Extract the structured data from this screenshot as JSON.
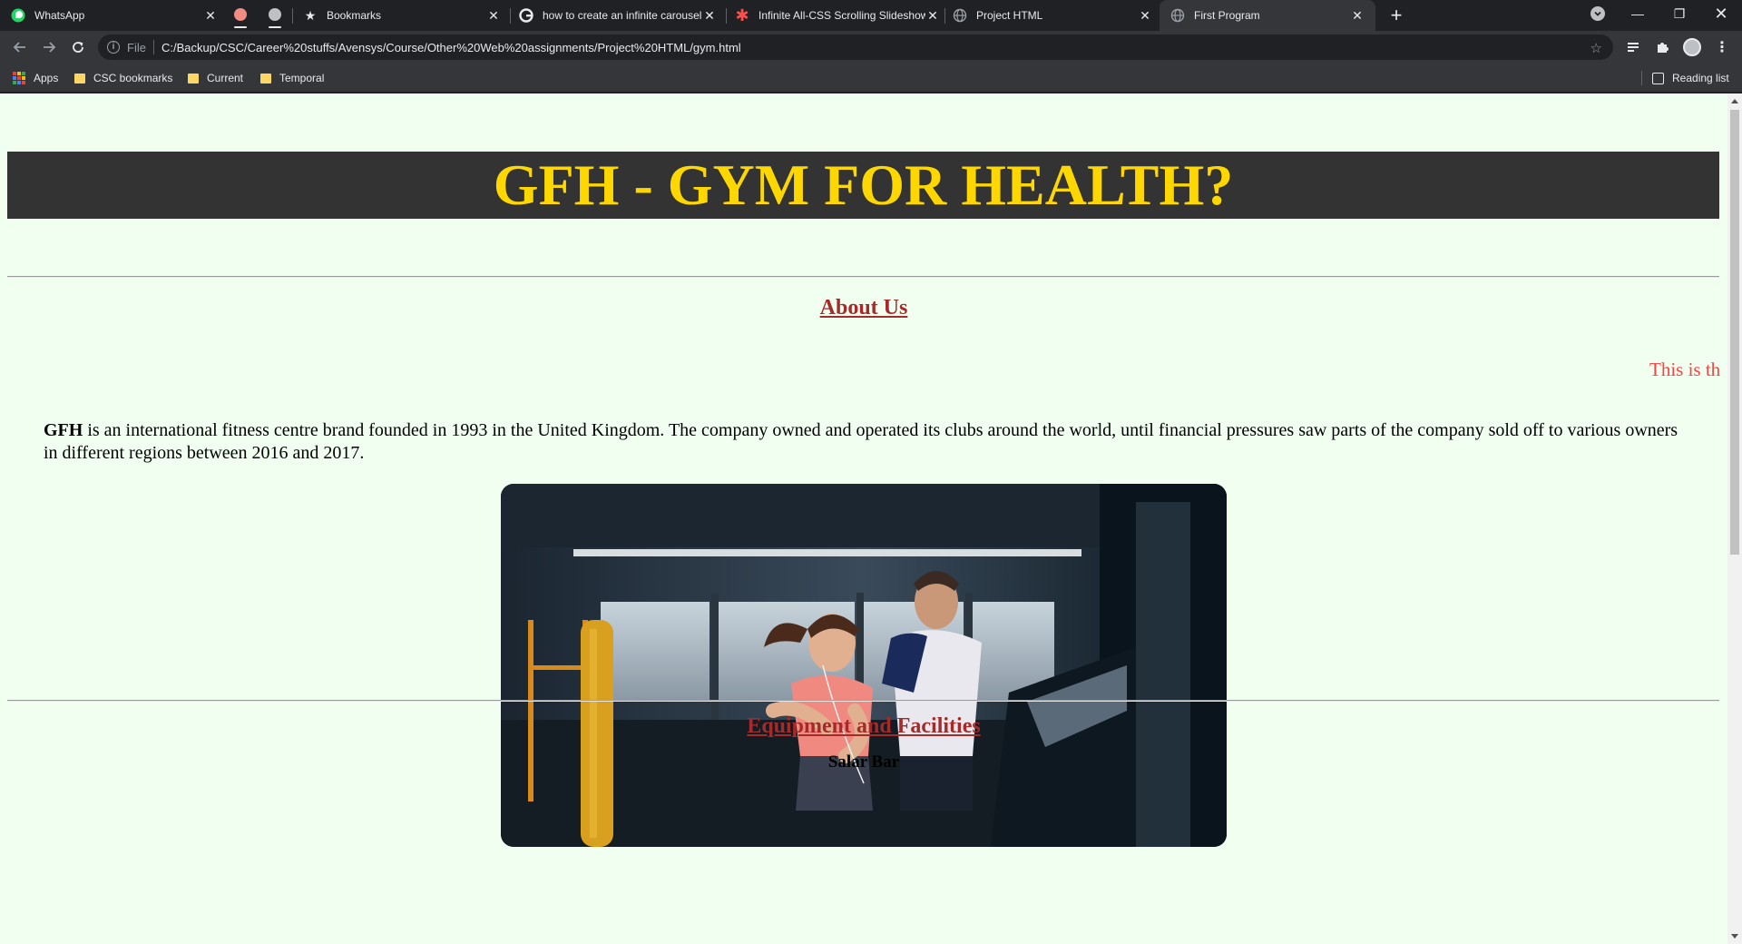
{
  "browser": {
    "tabs": [
      {
        "title": "WhatsApp",
        "icon": "whatsapp-icon"
      },
      {
        "title": "Bookmarks",
        "icon": "star-icon"
      },
      {
        "title": "how to create an infinite carousel",
        "icon": "google-icon"
      },
      {
        "title": "Infinite All-CSS Scrolling Slideshow",
        "icon": "asterisk-icon"
      },
      {
        "title": "Project HTML",
        "icon": "globe-icon"
      },
      {
        "title": "First Program",
        "icon": "globe-icon",
        "active": true
      }
    ],
    "new_tab_label": "+",
    "address": {
      "scheme_label": "File",
      "url": "C:/Backup/CSC/Career%20stuffs/Avensys/Course/Other%20Web%20assignments/Project%20HTML/gym.html"
    },
    "bookmarks": [
      {
        "label": "Apps",
        "icon": "apps-grid-icon"
      },
      {
        "label": "CSC bookmarks",
        "icon": "folder-icon"
      },
      {
        "label": "Current",
        "icon": "folder-icon"
      },
      {
        "label": "Temporal",
        "icon": "folder-icon"
      }
    ],
    "reading_list_label": "Reading list"
  },
  "page": {
    "header_title": "GFH - GYM FOR HEALTH?",
    "about_title": "About Us",
    "marquee_text": "This is th",
    "about_bold": "GFH",
    "about_text": " is an international fitness centre brand founded in 1993 in the United Kingdom. The company owned and operated its clubs around the world, until financial pressures saw parts of the company sold off to various owners in different regions between 2016 and 2017.",
    "equipment_title": "Equipment and Facilities",
    "equipment_sub": "Salar Bar"
  },
  "colors": {
    "page_bg": "#f0fff0",
    "header_bg": "#333333",
    "header_text": "#ffd700",
    "section_title": "#a52a2a",
    "marquee": "#ff4040"
  }
}
